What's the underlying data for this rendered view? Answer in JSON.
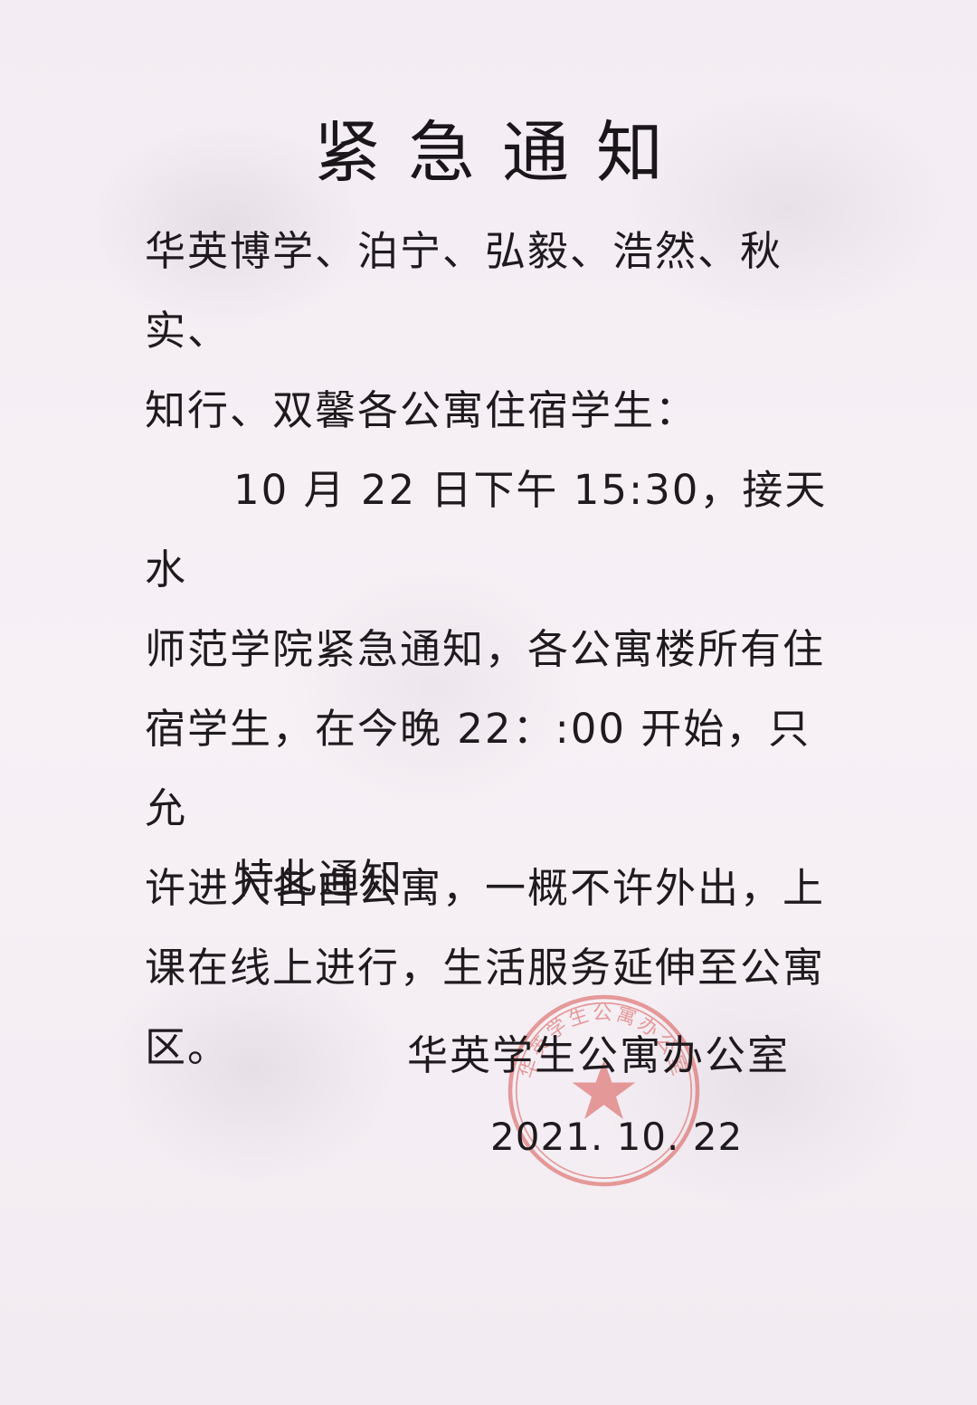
{
  "notice": {
    "title": "紧急通知",
    "recipients_line1": "华英博学、泊宁、弘毅、浩然、秋实、",
    "recipients_line2": "知行、双馨各公寓住宿学生：",
    "body_line1": "10 月 22 日下午 15:30，接天水",
    "body_line2": "师范学院紧急通知，各公寓楼所有住",
    "body_line3": "宿学生，在今晚 22：:00 开始，只允",
    "body_line4": "许进入各自公寓，一概不许外出，上",
    "body_line5": "课在线上进行，生活服务延伸至公寓",
    "body_line6": "区。",
    "closing": "特此通知",
    "signature_org": "华英学生公寓办公室",
    "signature_date": "2021. 10. 22"
  },
  "seal": {
    "text": "华英学生公寓办公室",
    "color": "#d9534f"
  }
}
